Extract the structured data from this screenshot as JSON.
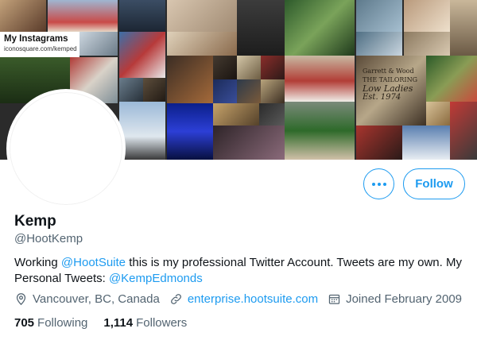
{
  "banner": {
    "card_title": "My Instagrams",
    "card_url": "iconosquare.com/kemped",
    "sign_texts": [
      "Garrett & Wood",
      "THE TAILORING",
      "Low Ladies",
      "Est. 1974"
    ]
  },
  "actions": {
    "more_label": "•••",
    "follow_label": "Follow"
  },
  "profile": {
    "name": "Kemp",
    "handle": "@HootKemp",
    "bio_prefix": "Working ",
    "bio_mention": "@HootSuite",
    "bio_middle": " this is my professional Twitter Account. Tweets are my own. My Personal Tweets: ",
    "bio_mention2": "@KempEdmonds"
  },
  "meta": {
    "location": "Vancouver, BC, Canada",
    "website": "enterprise.hootsuite.com",
    "joined": "Joined February 2009"
  },
  "stats": {
    "following_count": "705",
    "following_label": "Following",
    "followers_count": "1,114",
    "followers_label": "Followers"
  },
  "colors": {
    "accent": "#1d9bf0",
    "secondary_text": "#536471",
    "primary_text": "#0f1419"
  },
  "icons": {
    "location": "location-pin-icon",
    "link": "link-icon",
    "calendar": "calendar-icon"
  }
}
